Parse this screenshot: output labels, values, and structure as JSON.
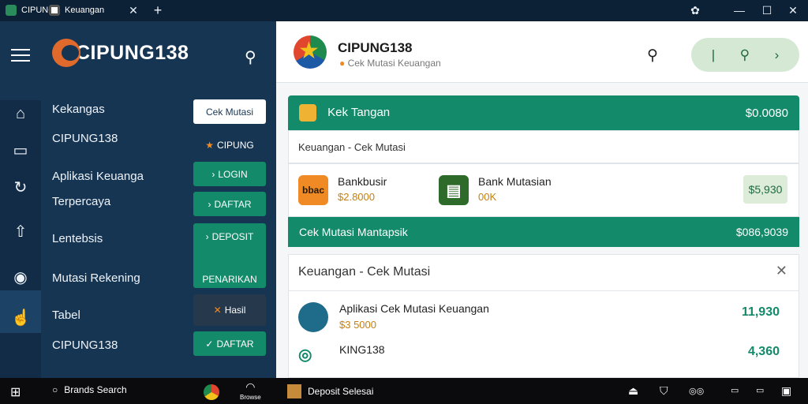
{
  "titlebar": {
    "tabs": [
      {
        "label": "CIPUNG",
        "icon": "globe-icon"
      },
      {
        "label": "Keuangan",
        "icon": "app-icon"
      }
    ],
    "close_tab": "✕",
    "new_tab": "+",
    "controls": [
      "settings-icon",
      "minimize-icon",
      "maximize-icon",
      "close-icon"
    ]
  },
  "sidebar": {
    "brand": "CIPUNG138",
    "items": [
      {
        "label": "Kekangas"
      },
      {
        "label": "CIPUNG138"
      },
      {
        "label": "Aplikasi Keuanga"
      },
      {
        "label": "Terpercaya"
      },
      {
        "label": "Lentebsis"
      },
      {
        "label": "Mutasi Rekening"
      },
      {
        "label": "Tabel"
      },
      {
        "label": "CIPUNG138"
      }
    ],
    "buttons": [
      {
        "label": "Cek Mutasi",
        "style": "white"
      },
      {
        "label": "CIPUNG",
        "style": "dark",
        "icon": "star-icon"
      },
      {
        "label": "LOGIN",
        "style": "green"
      },
      {
        "label": "DAFTAR",
        "style": "green"
      },
      {
        "label": "DEPOSIT",
        "style": "green"
      },
      {
        "label": "PENARIKAN",
        "style": "green"
      },
      {
        "label": "Hasil",
        "style": "dark"
      },
      {
        "label": "DAFTAR",
        "style": "green"
      }
    ]
  },
  "header": {
    "title": "CIPUNG138",
    "subtitle": "Cek Mutasi Keuangan"
  },
  "summary": {
    "label": "Kek Tangan",
    "amount": "$0.0080",
    "breadcrumb": "Keuangan - Cek Mutasi"
  },
  "accounts": [
    {
      "name": "Bankbusir",
      "amount": "$2.8000",
      "icon_text": "bbac",
      "icon_color": "#f08a24"
    },
    {
      "name": "Bank Mutasian",
      "amount": "00K",
      "icon_text": "▤",
      "icon_color": "#2e6a2a"
    }
  ],
  "account_badge": "$5,930",
  "balance": {
    "label": "Cek Mutasi Mantapsik",
    "amount": "$086,9039"
  },
  "mutations_panel": {
    "title": "Keuangan - Cek Mutasi",
    "items": [
      {
        "title": "Aplikasi Cek Mutasi Keuangan",
        "sub": "$3 5000",
        "amount": "11,930"
      },
      {
        "title": "KING138",
        "sub": "",
        "amount": "4,360"
      }
    ]
  },
  "taskbar": {
    "search": "Brands Search",
    "apps": [
      {
        "label": "",
        "icon": "chrome-icon"
      },
      {
        "label": "Browse",
        "icon": "browser-icon"
      },
      {
        "label": "Deposit Selesai",
        "icon": "app-icon"
      }
    ]
  },
  "colors": {
    "sidebar": "#163553",
    "accent": "#138a6a",
    "brand": "#e06a2b"
  }
}
